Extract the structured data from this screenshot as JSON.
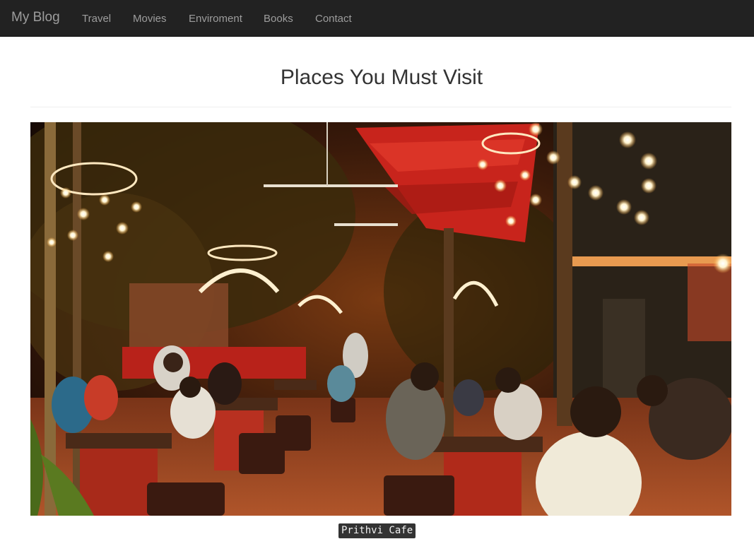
{
  "navbar": {
    "brand": "My Blog",
    "links": [
      "Travel",
      "Movies",
      "Enviroment",
      "Books",
      "Contact"
    ]
  },
  "main": {
    "title": "Places You Must Visit",
    "photo": {
      "subject": "Outdoor cafe courtyard at night with string lights, red canopy, bamboo and seated diners",
      "caption": "Prithvi Cafe"
    }
  },
  "colors": {
    "navbar_bg": "#222222",
    "nav_text": "#9d9d9d",
    "title_text": "#333333",
    "caption_bg": "#333333"
  }
}
